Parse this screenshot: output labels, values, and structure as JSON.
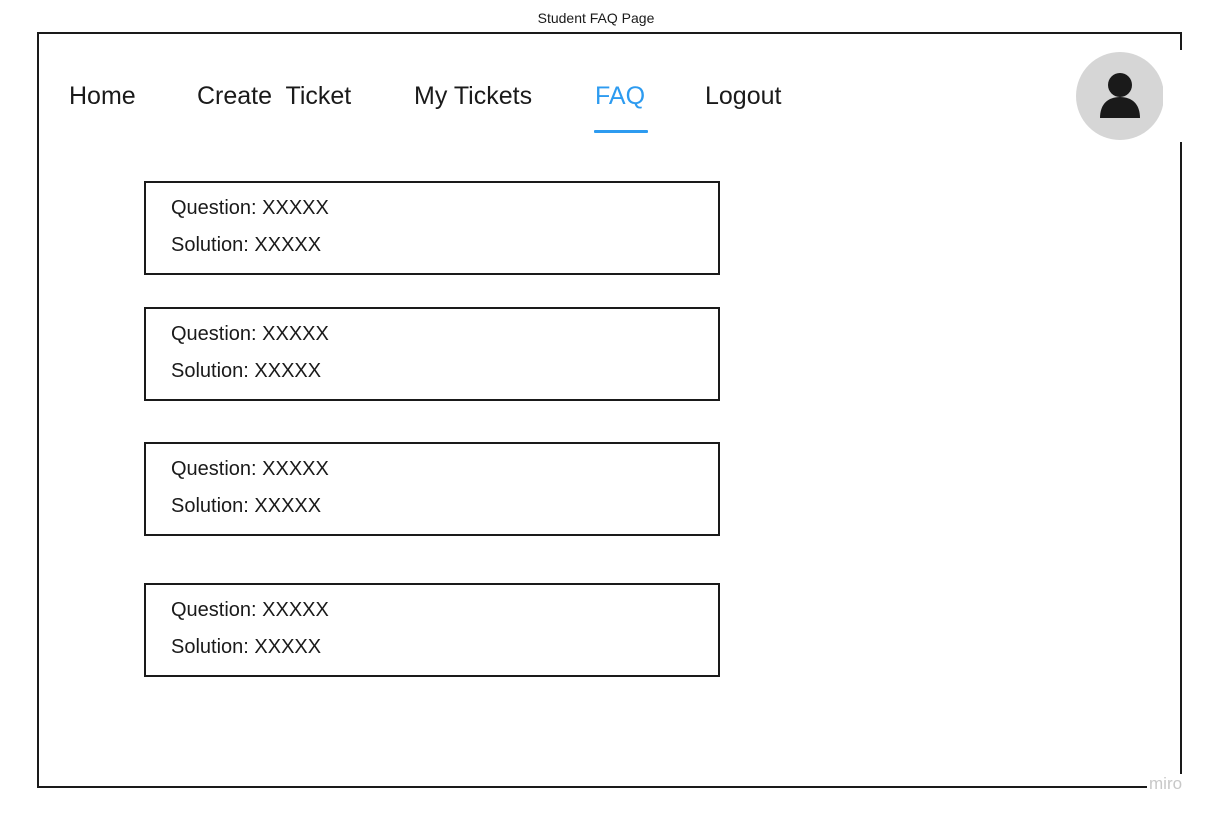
{
  "page": {
    "caption": "Student FAQ Page"
  },
  "nav": {
    "items": [
      {
        "label": "Home"
      },
      {
        "label": "Create  Ticket"
      },
      {
        "label": "My Tickets"
      },
      {
        "label": "FAQ",
        "active": true
      },
      {
        "label": "Logout"
      }
    ],
    "active_color": "#2d9bf0"
  },
  "profile": {
    "icon": "user-icon",
    "background": "#d6d6d6"
  },
  "faq": {
    "items": [
      {
        "question": "Question: XXXXX",
        "solution": "Solution: XXXXX"
      },
      {
        "question": "Question: XXXXX",
        "solution": "Solution: XXXXX"
      },
      {
        "question": "Question: XXXXX",
        "solution": "Solution: XXXXX"
      },
      {
        "question": "Question: XXXXX",
        "solution": "Solution: XXXXX"
      }
    ]
  },
  "watermark": {
    "text": "miro"
  }
}
